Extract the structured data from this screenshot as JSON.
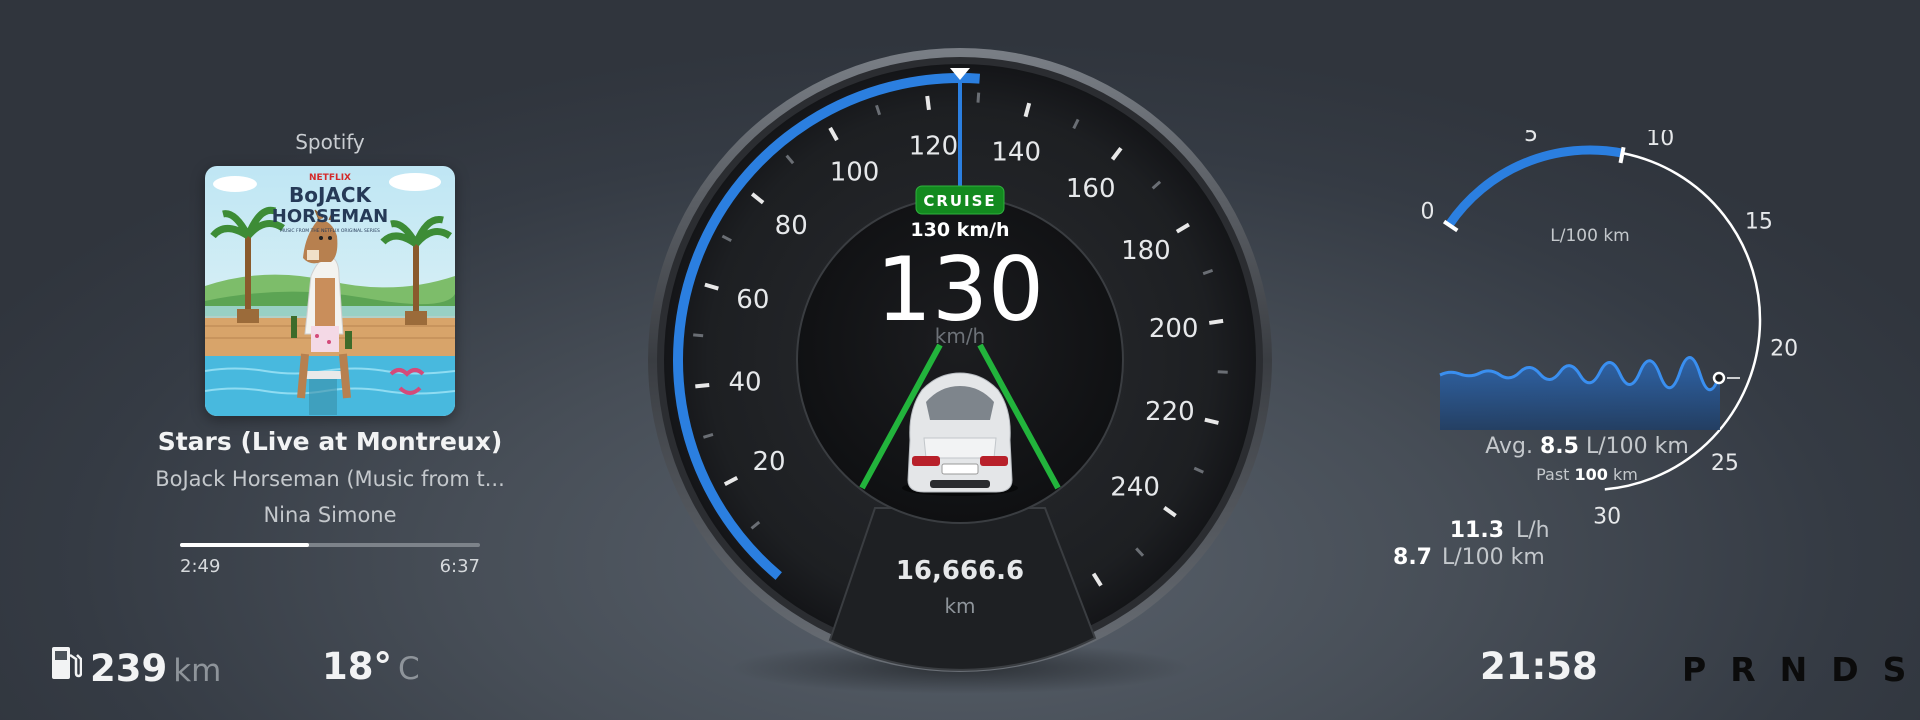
{
  "media": {
    "source": "Spotify",
    "album_art": {
      "publisher": "NETFLIX",
      "title_line1": "BoJACK",
      "title_line2": "HORSEMAN",
      "subtitle": "MUSIC FROM THE NETFLIX ORIGINAL SERIES"
    },
    "track_title": "Stars (Live at Montreux)",
    "album": "BoJack Horseman (Music from t...",
    "artist": "Nina Simone",
    "elapsed": "2:49",
    "duration": "6:37",
    "progress": 0.43
  },
  "speedometer": {
    "ticks": [
      "20",
      "40",
      "60",
      "80",
      "100",
      "120",
      "140",
      "160",
      "180",
      "200",
      "220",
      "240"
    ],
    "current_speed": "130",
    "speed_value": 130,
    "speed_unit": "km/h",
    "cruise_label": "CRUISE",
    "cruise_speed": "130 km/h",
    "odometer": "16,666.6",
    "odometer_unit": "km",
    "colors": {
      "arc": "#2b7fe0",
      "lane": "#22b43c",
      "cruise": "#138a1f"
    }
  },
  "consumption": {
    "gauge_ticks": [
      "0",
      "5",
      "10",
      "15",
      "20",
      "25",
      "30"
    ],
    "gauge_unit": "L/100 km",
    "gauge_value": 8.7,
    "avg_label": "Avg.",
    "avg_value": "8.5",
    "avg_unit": "L/100 km",
    "past_label": "Past",
    "past_value": "100",
    "past_unit": "km",
    "instant_lh_value": "11.3",
    "instant_lh_unit": "L/h",
    "instant_l100_value": "8.7",
    "instant_l100_unit": "L/100 km"
  },
  "status": {
    "range_value": "239",
    "range_unit": "km",
    "temperature_value": "18°",
    "temperature_unit": "C",
    "clock": "21:58",
    "gears": [
      "P",
      "R",
      "N",
      "D",
      "S"
    ]
  }
}
